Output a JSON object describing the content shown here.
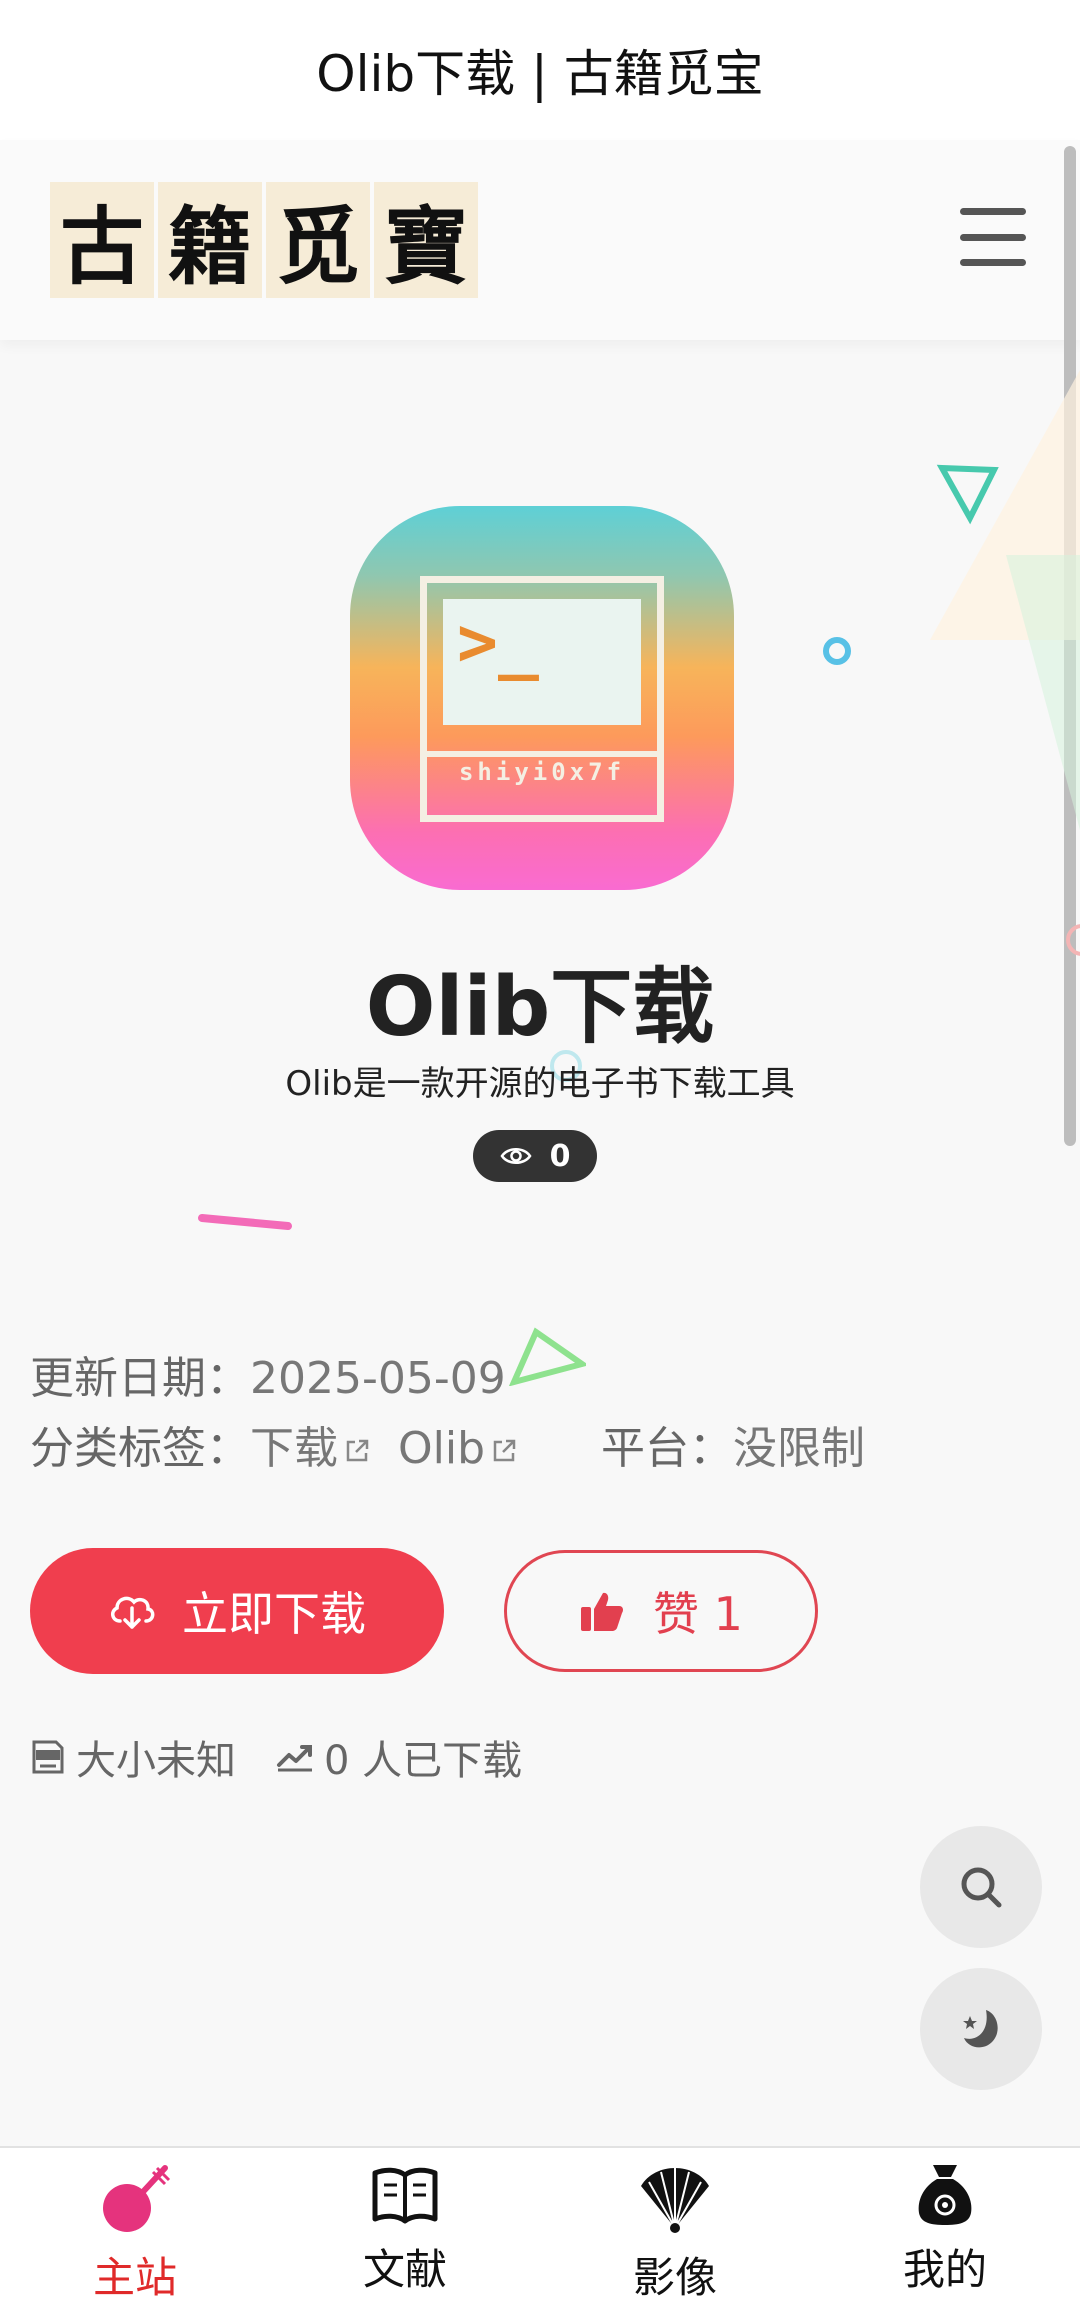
{
  "window": {
    "title": "Olib下载 | 古籍觅宝"
  },
  "header": {
    "logo_chars": [
      "古",
      "籍",
      "觅",
      "寶"
    ]
  },
  "app": {
    "icon_prompt": ">_",
    "icon_label": "shiyi0x7f",
    "name": "Olib下载",
    "description": "Olib是一款开源的电子书下载工具",
    "views": "0"
  },
  "meta": {
    "update_label": "更新日期：",
    "update_value": "2025-05-09",
    "tags_label": "分类标签：",
    "tags": [
      "下载",
      "Olib"
    ],
    "platform_label": "平台：",
    "platform_value": "没限制"
  },
  "actions": {
    "download_label": "立即下载",
    "like_label": "赞 1"
  },
  "stats": {
    "size": "大小未知",
    "downloads": "0 人已下载"
  },
  "tabbar": {
    "items": [
      {
        "label": "主站",
        "icon": "pipa-icon",
        "active": true
      },
      {
        "label": "文献",
        "icon": "book-icon",
        "active": false
      },
      {
        "label": "影像",
        "icon": "fan-icon",
        "active": false
      },
      {
        "label": "我的",
        "icon": "money-bag-icon",
        "active": false
      }
    ]
  },
  "colors": {
    "accent": "#f03e4e",
    "active_tab": "#e02a2a",
    "badge_bg": "#333333"
  }
}
